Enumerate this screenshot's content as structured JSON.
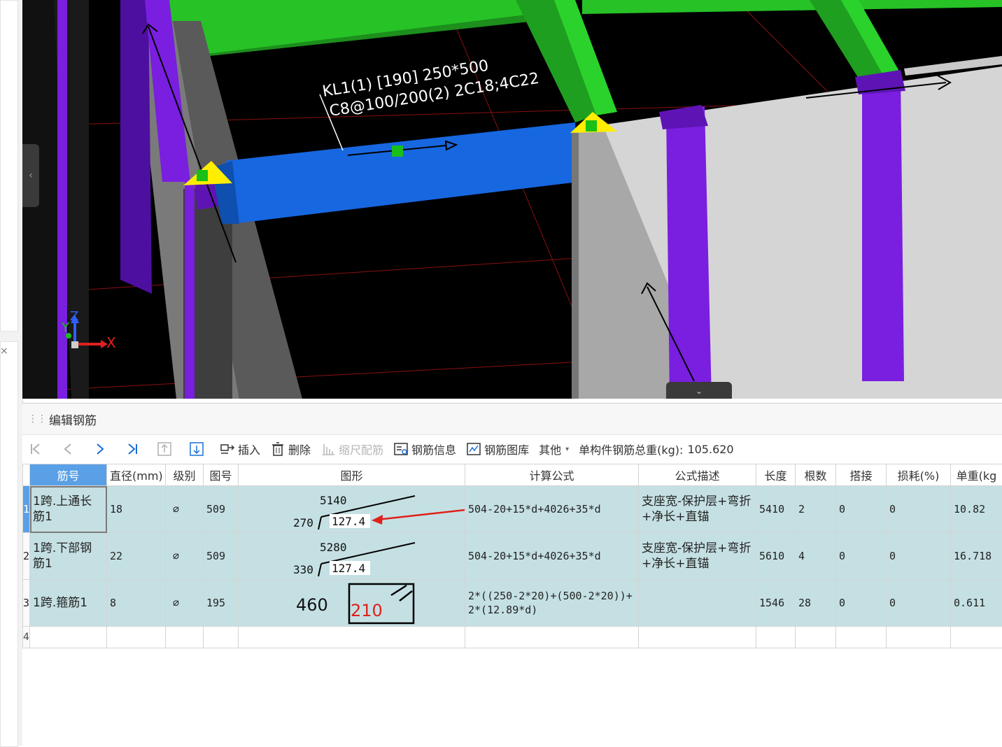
{
  "viewport": {
    "annotation_line1": "KL1(1) [190] 250*500",
    "annotation_line2": "C8@100/200(2) 2C18;4C22",
    "axis_x": "X",
    "axis_y": "Y",
    "axis_z": "Z",
    "collapse_left_glyph": "‹",
    "collapse_bottom_glyph": "⌄"
  },
  "panel": {
    "title": "编辑钢筋",
    "grip_glyph": "⋮⋮"
  },
  "toolbar": {
    "insert_label": "插入",
    "delete_label": "删除",
    "scale_rebar_label": "缩尺配筋",
    "rebar_info_label": "钢筋信息",
    "rebar_library_label": "钢筋图库",
    "other_label": "其他",
    "total_weight_label": "单构件钢筋总重(kg):",
    "total_weight_value": "105.620"
  },
  "table": {
    "headers": [
      "筋号",
      "直径(mm)",
      "级别",
      "图号",
      "图形",
      "计算公式",
      "公式描述",
      "长度",
      "根数",
      "搭接",
      "损耗(%)",
      "单重(kg"
    ],
    "rows": [
      {
        "row_no": "1",
        "name": "1跨.上通长筋1",
        "diameter": "18",
        "grade": "⌀",
        "fig_no": "509",
        "shape_top": "5140",
        "shape_left": "270",
        "shape_box": "127.4",
        "formula": "504-20+15*d+4026+35*d",
        "description": "支座宽-保护层+弯折+净长+直锚",
        "length": "5410",
        "count": "2",
        "lap": "0",
        "loss": "0",
        "unit_weight": "10.82"
      },
      {
        "row_no": "2",
        "name": "1跨.下部钢筋1",
        "diameter": "22",
        "grade": "⌀",
        "fig_no": "509",
        "shape_top": "5280",
        "shape_left": "330",
        "shape_box": "127.4",
        "formula": "504-20+15*d+4026+35*d",
        "description": "支座宽-保护层+弯折+净长+直锚",
        "length": "5610",
        "count": "4",
        "lap": "0",
        "loss": "0",
        "unit_weight": "16.718"
      },
      {
        "row_no": "3",
        "name": "1跨.箍筋1",
        "diameter": "8",
        "grade": "⌀",
        "fig_no": "195",
        "shape_left": "460",
        "shape_box": "210",
        "formula": "2*((250-2*20)+(500-2*20))+2*(12.89*d)",
        "description": "",
        "length": "1546",
        "count": "28",
        "lap": "0",
        "loss": "0",
        "unit_weight": "0.611"
      }
    ],
    "empty_row_no": "4"
  },
  "colors": {
    "beam_green": "#22b422",
    "beam_blue": "#1767e0",
    "column_purple": "#7a1ee0",
    "row_bg": "#c5e0e3",
    "header_selected": "#5aa0e6",
    "marker_yellow": "#ffee00",
    "arrow_red": "#e0201a"
  }
}
